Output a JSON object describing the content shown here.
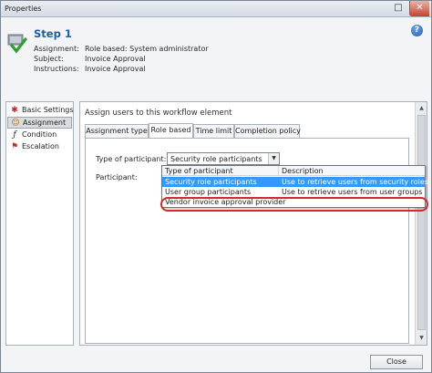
{
  "window": {
    "title": "Properties"
  },
  "header": {
    "step_title": "Step 1",
    "rows": [
      {
        "label": "Assignment:",
        "value": "Role based: System administrator"
      },
      {
        "label": "Subject:",
        "value": "Invoice Approval"
      },
      {
        "label": "Instructions:",
        "value": "Invoice Approval"
      }
    ],
    "help_glyph": "?"
  },
  "sidebar": {
    "items": [
      {
        "label": "Basic Settings",
        "icon": "star-icon"
      },
      {
        "label": "Assignment",
        "icon": "people-icon",
        "selected": true
      },
      {
        "label": "Condition",
        "icon": "function-icon"
      },
      {
        "label": "Escalation",
        "icon": "escalation-icon"
      }
    ]
  },
  "main": {
    "heading": "Assign users to this workflow element",
    "tabs": [
      {
        "label": "Assignment type"
      },
      {
        "label": "Role based",
        "active": true
      },
      {
        "label": "Time limit"
      },
      {
        "label": "Completion policy"
      }
    ],
    "type_label": "Type of participant:",
    "type_value": "Security role participants",
    "participant_label": "Participant:"
  },
  "dropdown": {
    "columns": [
      "Type of participant",
      "Description"
    ],
    "rows": [
      {
        "type": "Security role participants",
        "description": "Use to retrieve users from security roles",
        "selected": true
      },
      {
        "type": "User group participants",
        "description": "Use to retrieve users from user groups"
      },
      {
        "type": "Vendor invoice approval provider",
        "description": ""
      }
    ]
  },
  "footer": {
    "close_label": "Close"
  },
  "colors": {
    "accent": "#3399ff",
    "title_blue": "#1a5ea8",
    "highlight": "#d42a2a"
  }
}
